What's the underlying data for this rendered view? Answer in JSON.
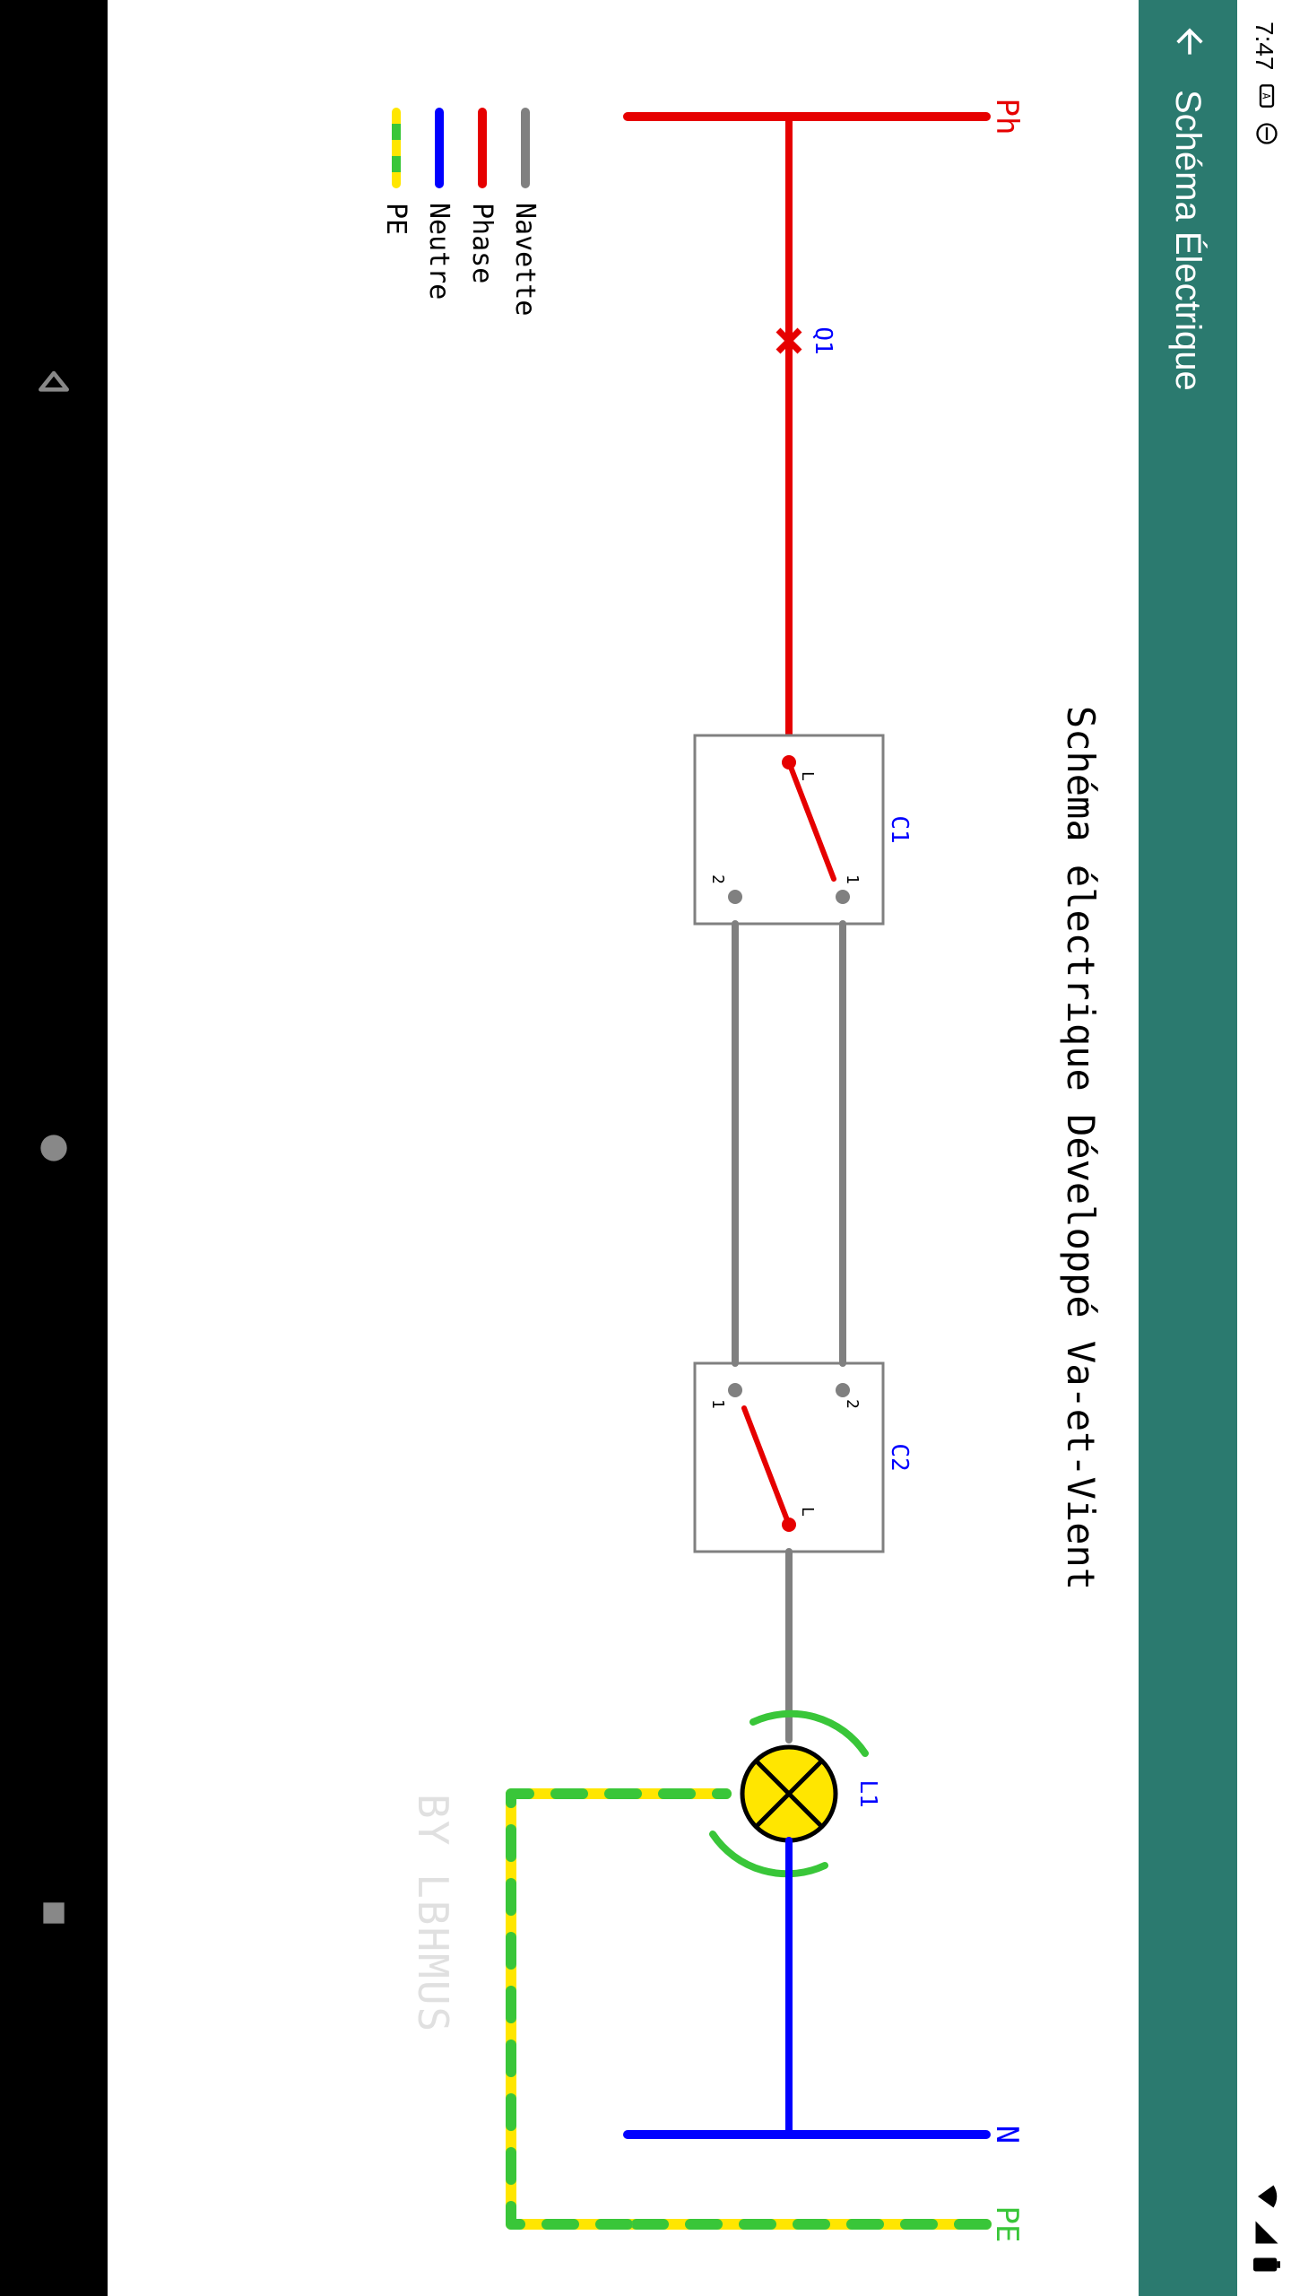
{
  "status": {
    "time": "7:47"
  },
  "appbar": {
    "title": "Schéma Électrique"
  },
  "diagram": {
    "title": "Schéma électrique Développé Va-et-Vient",
    "labels": {
      "ph": "Ph",
      "n": "N",
      "pe": "PE",
      "q1": "Q1",
      "c1": "C1",
      "c2": "C2",
      "l1": "L1",
      "sw_L": "L",
      "sw_1": "1",
      "sw_2": "2"
    },
    "legend": {
      "navette": "Navette",
      "phase": "Phase",
      "neutre": "Neutre",
      "pe": "PE"
    },
    "colors": {
      "phase": "#e60000",
      "neutre": "#0000ff",
      "navette": "#808080",
      "pe_yellow": "#ffe600",
      "pe_green": "#39c639",
      "component_label": "#0000ff",
      "terminal_label": "#2b7a6f"
    },
    "watermark": "BY LBHMUS"
  }
}
